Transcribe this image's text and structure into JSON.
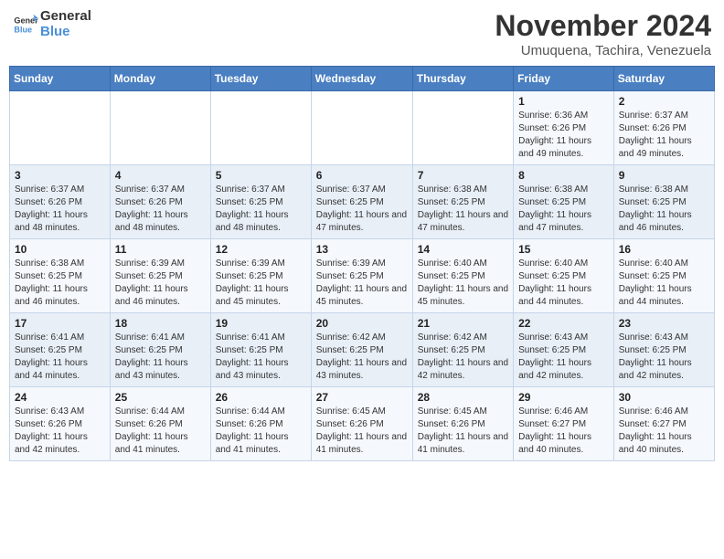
{
  "header": {
    "logo_line1": "General",
    "logo_line2": "Blue",
    "month_title": "November 2024",
    "subtitle": "Umuquena, Tachira, Venezuela"
  },
  "days_of_week": [
    "Sunday",
    "Monday",
    "Tuesday",
    "Wednesday",
    "Thursday",
    "Friday",
    "Saturday"
  ],
  "weeks": [
    [
      {
        "num": "",
        "info": ""
      },
      {
        "num": "",
        "info": ""
      },
      {
        "num": "",
        "info": ""
      },
      {
        "num": "",
        "info": ""
      },
      {
        "num": "",
        "info": ""
      },
      {
        "num": "1",
        "info": "Sunrise: 6:36 AM\nSunset: 6:26 PM\nDaylight: 11 hours and 49 minutes."
      },
      {
        "num": "2",
        "info": "Sunrise: 6:37 AM\nSunset: 6:26 PM\nDaylight: 11 hours and 49 minutes."
      }
    ],
    [
      {
        "num": "3",
        "info": "Sunrise: 6:37 AM\nSunset: 6:26 PM\nDaylight: 11 hours and 48 minutes."
      },
      {
        "num": "4",
        "info": "Sunrise: 6:37 AM\nSunset: 6:26 PM\nDaylight: 11 hours and 48 minutes."
      },
      {
        "num": "5",
        "info": "Sunrise: 6:37 AM\nSunset: 6:25 PM\nDaylight: 11 hours and 48 minutes."
      },
      {
        "num": "6",
        "info": "Sunrise: 6:37 AM\nSunset: 6:25 PM\nDaylight: 11 hours and 47 minutes."
      },
      {
        "num": "7",
        "info": "Sunrise: 6:38 AM\nSunset: 6:25 PM\nDaylight: 11 hours and 47 minutes."
      },
      {
        "num": "8",
        "info": "Sunrise: 6:38 AM\nSunset: 6:25 PM\nDaylight: 11 hours and 47 minutes."
      },
      {
        "num": "9",
        "info": "Sunrise: 6:38 AM\nSunset: 6:25 PM\nDaylight: 11 hours and 46 minutes."
      }
    ],
    [
      {
        "num": "10",
        "info": "Sunrise: 6:38 AM\nSunset: 6:25 PM\nDaylight: 11 hours and 46 minutes."
      },
      {
        "num": "11",
        "info": "Sunrise: 6:39 AM\nSunset: 6:25 PM\nDaylight: 11 hours and 46 minutes."
      },
      {
        "num": "12",
        "info": "Sunrise: 6:39 AM\nSunset: 6:25 PM\nDaylight: 11 hours and 45 minutes."
      },
      {
        "num": "13",
        "info": "Sunrise: 6:39 AM\nSunset: 6:25 PM\nDaylight: 11 hours and 45 minutes."
      },
      {
        "num": "14",
        "info": "Sunrise: 6:40 AM\nSunset: 6:25 PM\nDaylight: 11 hours and 45 minutes."
      },
      {
        "num": "15",
        "info": "Sunrise: 6:40 AM\nSunset: 6:25 PM\nDaylight: 11 hours and 44 minutes."
      },
      {
        "num": "16",
        "info": "Sunrise: 6:40 AM\nSunset: 6:25 PM\nDaylight: 11 hours and 44 minutes."
      }
    ],
    [
      {
        "num": "17",
        "info": "Sunrise: 6:41 AM\nSunset: 6:25 PM\nDaylight: 11 hours and 44 minutes."
      },
      {
        "num": "18",
        "info": "Sunrise: 6:41 AM\nSunset: 6:25 PM\nDaylight: 11 hours and 43 minutes."
      },
      {
        "num": "19",
        "info": "Sunrise: 6:41 AM\nSunset: 6:25 PM\nDaylight: 11 hours and 43 minutes."
      },
      {
        "num": "20",
        "info": "Sunrise: 6:42 AM\nSunset: 6:25 PM\nDaylight: 11 hours and 43 minutes."
      },
      {
        "num": "21",
        "info": "Sunrise: 6:42 AM\nSunset: 6:25 PM\nDaylight: 11 hours and 42 minutes."
      },
      {
        "num": "22",
        "info": "Sunrise: 6:43 AM\nSunset: 6:25 PM\nDaylight: 11 hours and 42 minutes."
      },
      {
        "num": "23",
        "info": "Sunrise: 6:43 AM\nSunset: 6:25 PM\nDaylight: 11 hours and 42 minutes."
      }
    ],
    [
      {
        "num": "24",
        "info": "Sunrise: 6:43 AM\nSunset: 6:26 PM\nDaylight: 11 hours and 42 minutes."
      },
      {
        "num": "25",
        "info": "Sunrise: 6:44 AM\nSunset: 6:26 PM\nDaylight: 11 hours and 41 minutes."
      },
      {
        "num": "26",
        "info": "Sunrise: 6:44 AM\nSunset: 6:26 PM\nDaylight: 11 hours and 41 minutes."
      },
      {
        "num": "27",
        "info": "Sunrise: 6:45 AM\nSunset: 6:26 PM\nDaylight: 11 hours and 41 minutes."
      },
      {
        "num": "28",
        "info": "Sunrise: 6:45 AM\nSunset: 6:26 PM\nDaylight: 11 hours and 41 minutes."
      },
      {
        "num": "29",
        "info": "Sunrise: 6:46 AM\nSunset: 6:27 PM\nDaylight: 11 hours and 40 minutes."
      },
      {
        "num": "30",
        "info": "Sunrise: 6:46 AM\nSunset: 6:27 PM\nDaylight: 11 hours and 40 minutes."
      }
    ]
  ]
}
